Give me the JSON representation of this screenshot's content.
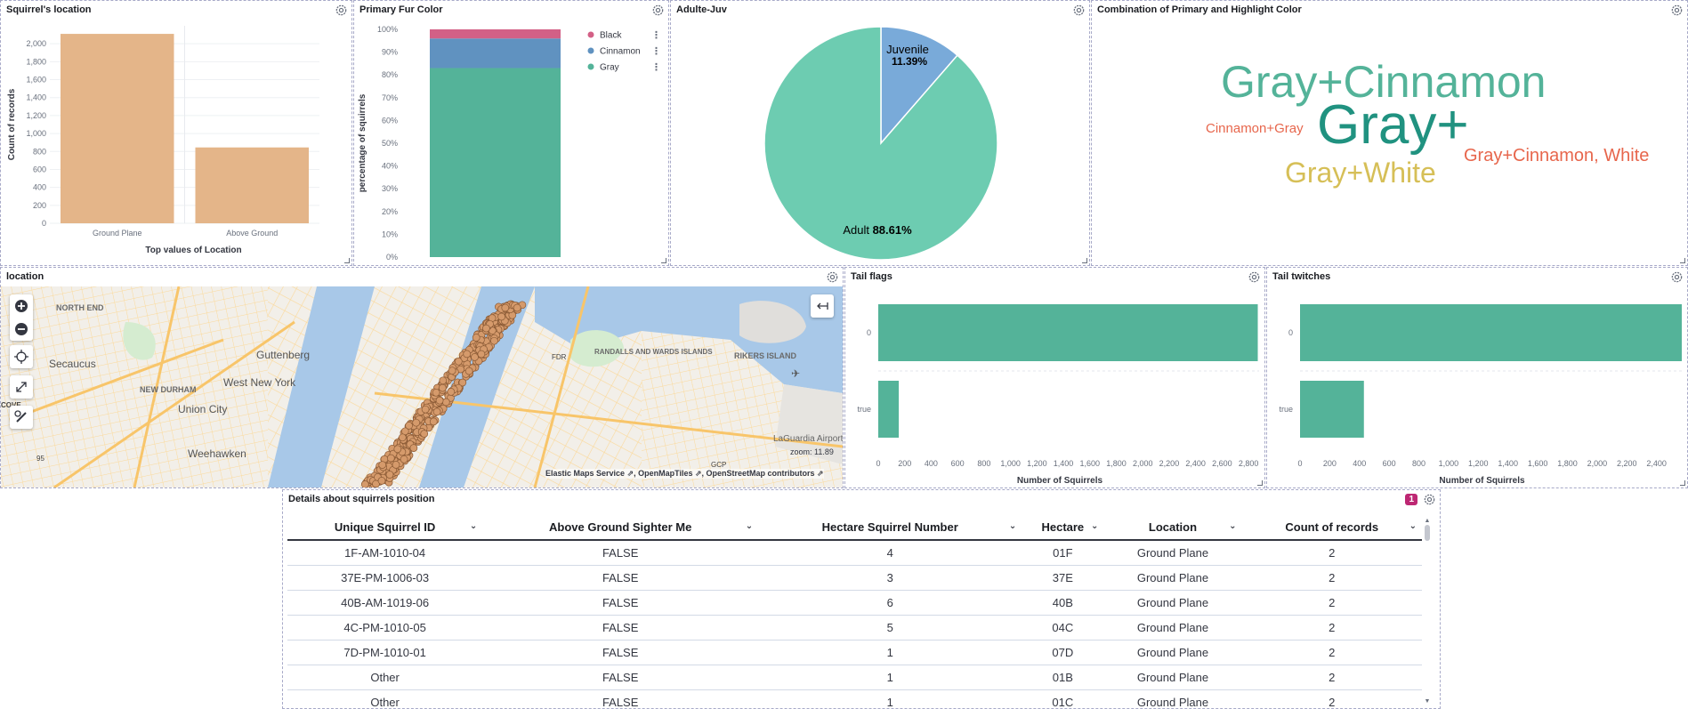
{
  "panels": {
    "squirrel_location": {
      "title": "Squirrel's location"
    },
    "fur_color": {
      "title": "Primary Fur Color"
    },
    "adult_juv": {
      "title": "Adulte-Juv"
    },
    "combo_color": {
      "title": "Combination of Primary and Highlight Color"
    },
    "location_map": {
      "title": "location"
    },
    "tail_flags": {
      "title": "Tail flags"
    },
    "tail_twitches": {
      "title": "Tail twitches"
    },
    "details": {
      "title": "Details about squirrels position",
      "badge": "1"
    }
  },
  "chart_data": [
    {
      "id": "squirrel_location",
      "type": "bar",
      "categories": [
        "Ground Plane",
        "Above Ground"
      ],
      "values": [
        2110,
        845
      ],
      "ylim": [
        0,
        2200
      ],
      "yticks": [
        0,
        200,
        400,
        600,
        800,
        1000,
        1200,
        1400,
        1600,
        1800,
        2000
      ],
      "ytick_labels": [
        "0",
        "200",
        "400",
        "600",
        "800",
        "1,000",
        "1,200",
        "1,400",
        "1,600",
        "1,800",
        "2,000"
      ],
      "xlabel": "Top values of Location",
      "ylabel": "Count of records",
      "color": "#e4b589"
    },
    {
      "id": "fur_color",
      "type": "bar",
      "stacked": "percent",
      "series": [
        {
          "name": "Gray",
          "value": 83,
          "color": "#54b399"
        },
        {
          "name": "Cinnamon",
          "value": 13,
          "color": "#6092c0"
        },
        {
          "name": "Black",
          "value": 4,
          "color": "#d36086"
        }
      ],
      "legend": [
        "Black",
        "Cinnamon",
        "Gray"
      ],
      "ytick_labels": [
        "0%",
        "10%",
        "20%",
        "30%",
        "40%",
        "50%",
        "60%",
        "70%",
        "80%",
        "90%",
        "100%"
      ],
      "ylabel": "percentage of squirrels"
    },
    {
      "id": "adult_juv",
      "type": "pie",
      "slices": [
        {
          "label": "Juvenile",
          "value": 11.39,
          "display": "11.39%",
          "color": "#79aad9"
        },
        {
          "label": "Adult",
          "value": 88.61,
          "display": "88.61%",
          "color": "#6dccb1"
        }
      ]
    },
    {
      "id": "tail_flags",
      "type": "bar",
      "orientation": "horizontal",
      "categories": [
        "0",
        "true"
      ],
      "values": [
        2870,
        155
      ],
      "xlim": [
        0,
        2880
      ],
      "xticks": [
        0,
        200,
        400,
        600,
        800,
        1000,
        1200,
        1400,
        1600,
        1800,
        2000,
        2200,
        2400,
        2600,
        2800
      ],
      "xtick_labels": [
        "0",
        "200",
        "400",
        "600",
        "800",
        "1,000",
        "1,200",
        "1,400",
        "1,600",
        "1,800",
        "2,000",
        "2,200",
        "2,400",
        "2,600",
        "2,800"
      ],
      "xlabel": "Number of Squirrels",
      "color": "#54b399"
    },
    {
      "id": "tail_twitches",
      "type": "bar",
      "orientation": "horizontal",
      "categories": [
        "0",
        "true"
      ],
      "values": [
        2570,
        430
      ],
      "xlim": [
        0,
        2570
      ],
      "xticks": [
        0,
        200,
        400,
        600,
        800,
        1000,
        1200,
        1400,
        1600,
        1800,
        2000,
        2200,
        2400
      ],
      "xtick_labels": [
        "0",
        "200",
        "400",
        "600",
        "800",
        "1,000",
        "1,200",
        "1,400",
        "1,600",
        "1,800",
        "2,000",
        "2,200",
        "2,400"
      ],
      "xlabel": "Number of Squirrels",
      "color": "#54b399"
    }
  ],
  "word_cloud": [
    {
      "text": "Gray+Cinnamon",
      "color": "#54b399"
    },
    {
      "text": "Gray+",
      "color": "#209280"
    },
    {
      "text": "Cinnamon+Gray",
      "color": "#e7664c"
    },
    {
      "text": "Gray+White",
      "color": "#d6bf57"
    },
    {
      "text": "Gray+Cinnamon, White",
      "color": "#e7664c"
    }
  ],
  "map": {
    "labels": [
      "NORTH END",
      "Secaucus",
      "NEW DURHAM",
      "West New York",
      "Guttenberg",
      "Union City",
      "Weehawken",
      "RANDALLS AND WARDS ISLANDS",
      "RIKERS ISLAND",
      "LaGuardia Airport",
      "FDR",
      "COVE",
      "95",
      "GCP"
    ],
    "zoom_text": "zoom: 11.89",
    "attribution": [
      "Elastic Maps Service",
      "OpenMapTiles",
      "OpenStreetMap contributors"
    ]
  },
  "table": {
    "columns": [
      "Unique Squirrel ID",
      "Above Ground Sighter Me",
      "Hectare Squirrel Number",
      "Hectare",
      "Location",
      "Count of records"
    ],
    "rows": [
      [
        "1F-AM-1010-04",
        "FALSE",
        "4",
        "01F",
        "Ground Plane",
        "2"
      ],
      [
        "37E-PM-1006-03",
        "FALSE",
        "3",
        "37E",
        "Ground Plane",
        "2"
      ],
      [
        "40B-AM-1019-06",
        "FALSE",
        "6",
        "40B",
        "Ground Plane",
        "2"
      ],
      [
        "4C-PM-1010-05",
        "FALSE",
        "5",
        "04C",
        "Ground Plane",
        "2"
      ],
      [
        "7D-PM-1010-01",
        "FALSE",
        "1",
        "07D",
        "Ground Plane",
        "2"
      ],
      [
        "Other",
        "FALSE",
        "1",
        "01B",
        "Ground Plane",
        "2"
      ],
      [
        "Other",
        "FALSE",
        "1",
        "01C",
        "Ground Plane",
        "2"
      ]
    ]
  }
}
